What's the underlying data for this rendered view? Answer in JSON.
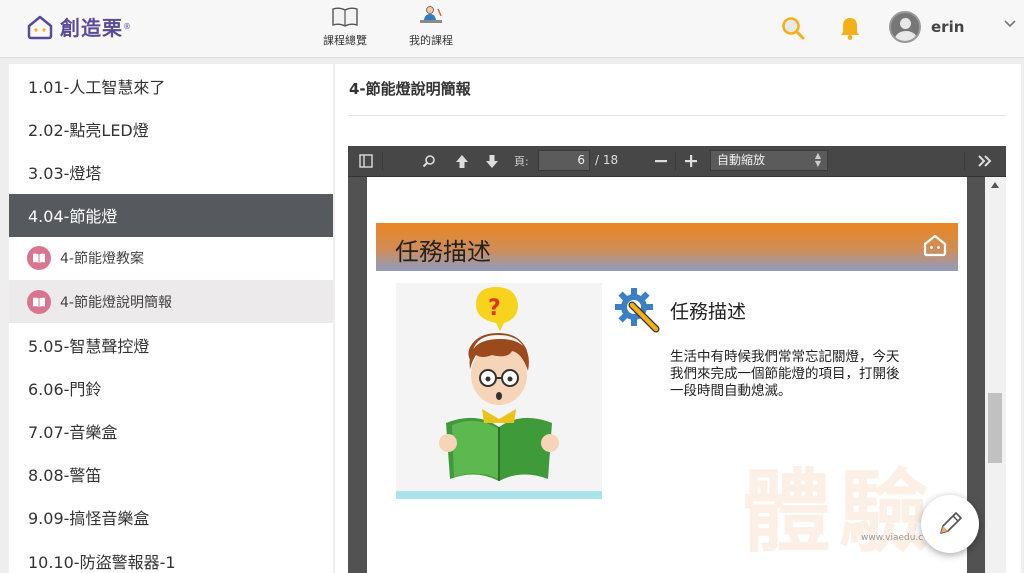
{
  "header": {
    "brand_name": "創造栗",
    "brand_mark": "®",
    "nav": [
      {
        "label": "課程總覽",
        "icon": "open-book-icon"
      },
      {
        "label": "我的課程",
        "icon": "student-desk-icon"
      }
    ],
    "search_icon": "search-icon",
    "notification_icon": "bell-icon",
    "username": "erin",
    "accent_color": "#f2b019"
  },
  "sidebar": {
    "items": [
      {
        "label": "1.01-人工智慧來了"
      },
      {
        "label": "2.02-點亮LED燈"
      },
      {
        "label": "3.03-燈塔"
      },
      {
        "label": "4.04-節能燈",
        "active": true
      },
      {
        "label": "5.05-智慧聲控燈"
      },
      {
        "label": "6.06-門鈴"
      },
      {
        "label": "7.07-音樂盒"
      },
      {
        "label": "8.08-警笛"
      },
      {
        "label": "9.09-搞怪音樂盒"
      },
      {
        "label": "10.10-防盜警報器-1"
      }
    ],
    "subitems": [
      {
        "label": "4-節能燈教案"
      },
      {
        "label": "4-節能燈說明簡報",
        "selected": true
      }
    ],
    "badge_color": "#d9758f"
  },
  "main": {
    "title": "4-節能燈說明簡報",
    "pdf": {
      "page_label": "頁:",
      "current_page": "6",
      "total_pages": "/ 18",
      "zoom": "自動縮放",
      "slide": {
        "banner_title": "任務描述",
        "task_title": "任務描述",
        "task_body": "生活中有時候我們常常忘記關燈，今天我們來完成一個節能燈的項目，打開後一段時間自動熄滅。",
        "watermark": "體驗",
        "watermark_url": "www.viaedu.c"
      }
    }
  }
}
